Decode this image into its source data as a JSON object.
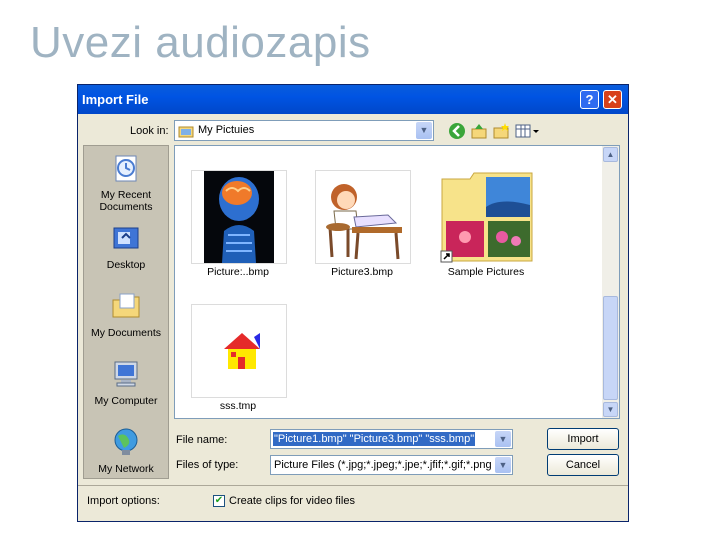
{
  "slide": {
    "title": "Uvezi audiozapis"
  },
  "dialog": {
    "title": "Import File",
    "help_glyph": "?",
    "close_glyph": "✕",
    "look_in_label": "Look in:",
    "look_in_value": "My Pictuies",
    "places": [
      {
        "label": "My Recent Documents",
        "icon": "recent-documents-icon"
      },
      {
        "label": "Desktop",
        "icon": "desktop-icon"
      },
      {
        "label": "My Documents",
        "icon": "my-documents-icon"
      },
      {
        "label": "My Computer",
        "icon": "my-computer-icon"
      },
      {
        "label": "My Network",
        "icon": "my-network-icon"
      }
    ],
    "files": [
      {
        "name": "Picture:..bmp"
      },
      {
        "name": "Picture3.bmp"
      },
      {
        "name": "Sample Pictures"
      },
      {
        "name": "sss.tmp"
      }
    ],
    "file_name_label": "File name:",
    "file_name_value": "\"Picture1.bmp\" \"Picture3.bmp\" \"sss.bmp\"",
    "file_type_label": "Files of type:",
    "file_type_value": "Picture Files (*.jpg;*.jpeg;*.jpe;*.jfif;*.gif;*.png;*.b",
    "import_button": "Import",
    "cancel_button": "Cancel",
    "import_options_label": "Import options:",
    "create_clips_label": "Create clips for video files",
    "create_clips_checked": true
  }
}
